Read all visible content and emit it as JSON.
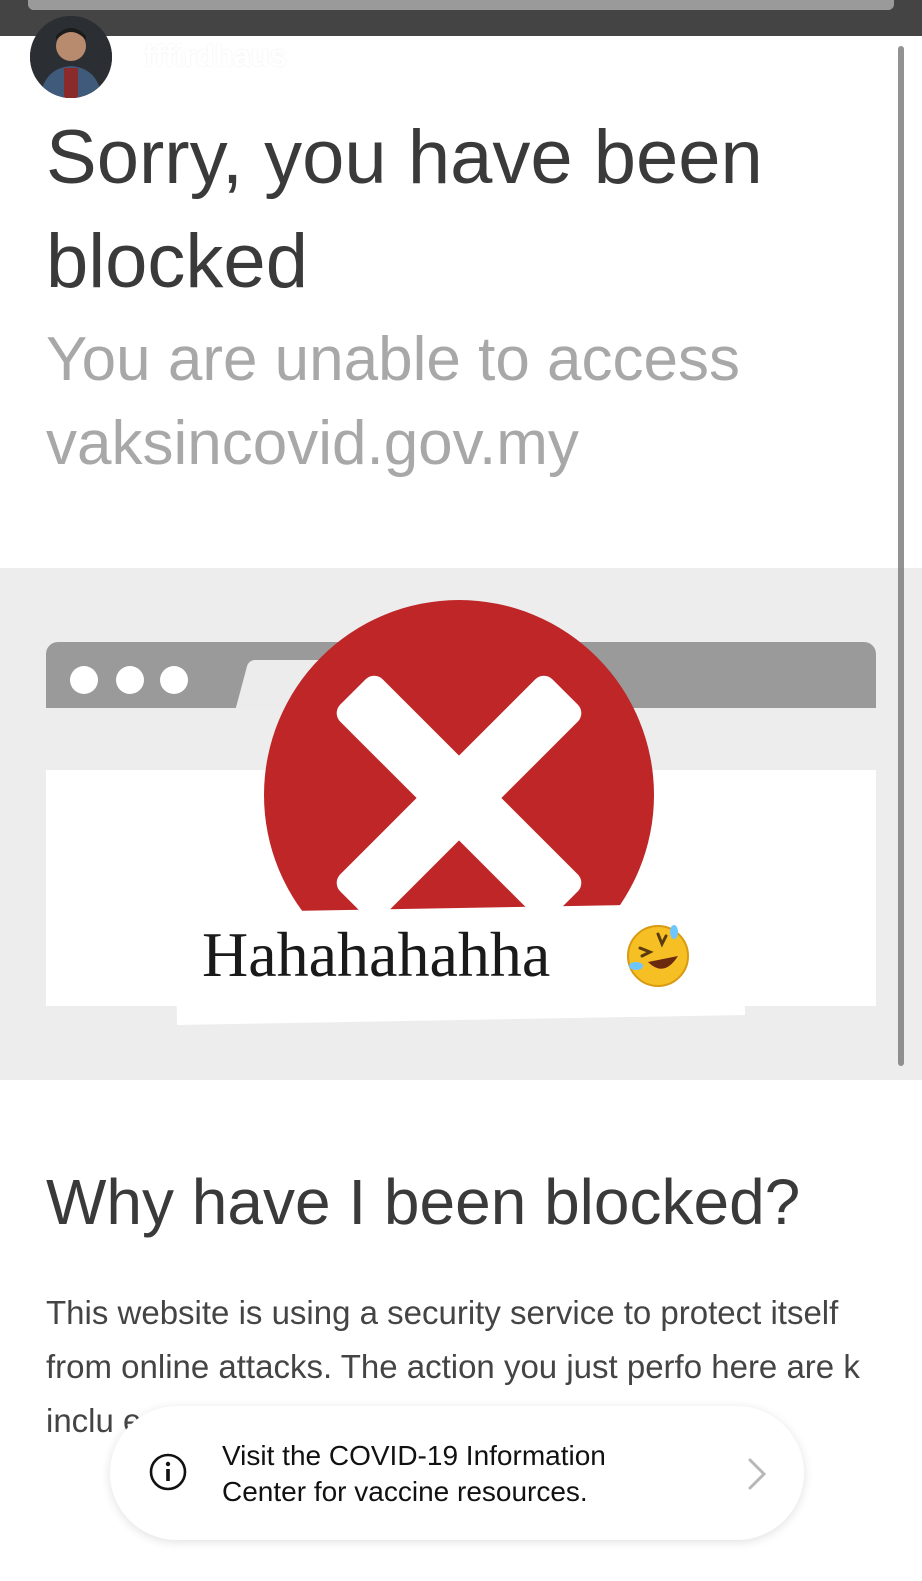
{
  "story_header": {
    "username": "fffirdhaus",
    "time_ago": "4h",
    "progress_fraction": 1.0
  },
  "blocked_page": {
    "title": "Sorry, you have been blocked",
    "subtitle": "You are unable to access vaksincovid.gov.my",
    "section_heading": "Why have I been blocked?",
    "body_visible": "This website is using a security service to protect itself from online attacks. The action you just perfo    here are    k inclu    e, a"
  },
  "sticker": {
    "text": "Hahahahahha",
    "emoji": "🤣",
    "emoji_icon": "rolling-on-floor-laughing-icon"
  },
  "toast": {
    "message": "Visit the COVID-19 Information Center for vaccine resources.",
    "icon": "info-icon",
    "chevron_icon": "chevron-right-icon"
  },
  "colors": {
    "top_bar": "#444444",
    "error_red": "#be2628",
    "title_text": "#3a3a3a",
    "subtitle_text": "#a8a8a8",
    "band_gray": "#ededed",
    "browser_bar": "#9a9a9a"
  }
}
